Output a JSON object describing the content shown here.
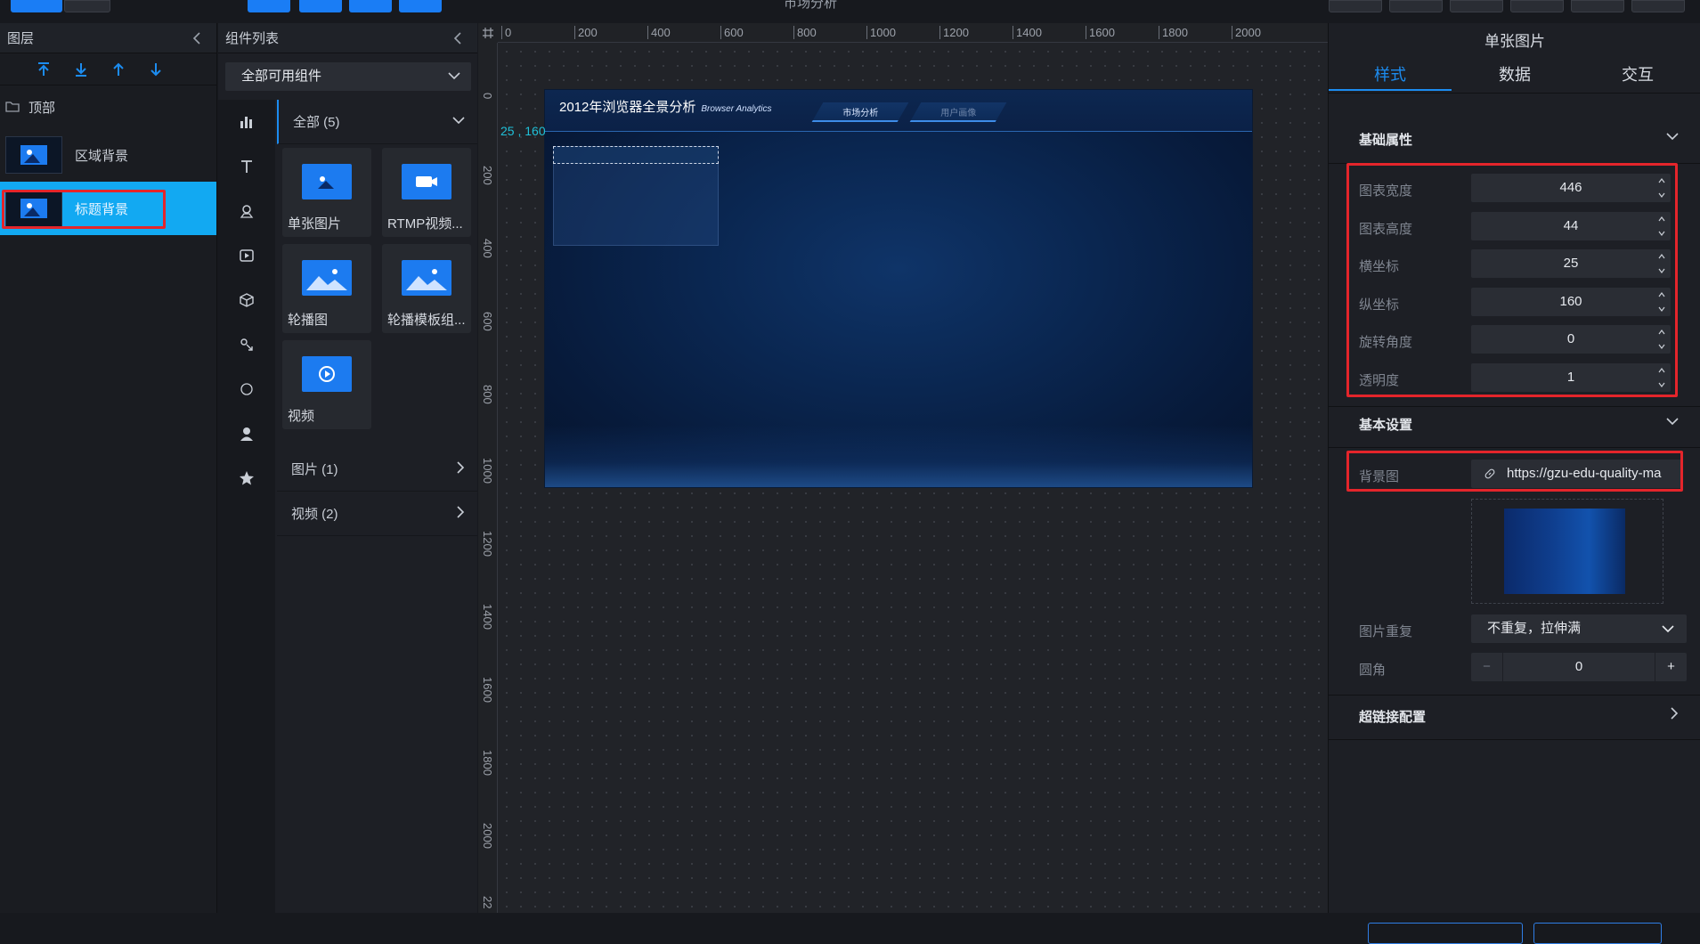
{
  "topbar": {
    "title": "市场分析"
  },
  "layers": {
    "title": "图层",
    "group": "顶部",
    "items": [
      {
        "label": "区域背景"
      },
      {
        "label": "标题背景"
      }
    ]
  },
  "components": {
    "title": "组件列表",
    "filter": "全部可用组件",
    "groups": [
      {
        "label": "全部 (5)"
      },
      {
        "label": "图片 (1)"
      },
      {
        "label": "视频 (2)"
      }
    ],
    "tiles": [
      {
        "label": "单张图片"
      },
      {
        "label": "RTMP视频..."
      },
      {
        "label": "轮播图"
      },
      {
        "label": "轮播模板组..."
      },
      {
        "label": "视频"
      }
    ]
  },
  "canvas": {
    "ruler_top": [
      "0",
      "200",
      "400",
      "600",
      "800",
      "1000",
      "1200",
      "1400",
      "1600",
      "1800",
      "2000"
    ],
    "ruler_left": [
      "0",
      "200",
      "400",
      "600",
      "800",
      "1000",
      "1200",
      "1400",
      "1600",
      "1800",
      "2000",
      "22"
    ],
    "coord": "25 , 160",
    "screen_title": "2012年浏览器全景分析",
    "screen_subtitle": "Browser Analytics",
    "tab1": "市场分析",
    "tab2": "用户画像"
  },
  "props": {
    "title": "单张图片",
    "tabs": [
      "样式",
      "数据",
      "交互"
    ],
    "section_basic": "基础属性",
    "fields": [
      {
        "label": "图表宽度",
        "value": "446"
      },
      {
        "label": "图表高度",
        "value": "44"
      },
      {
        "label": "横坐标",
        "value": "25"
      },
      {
        "label": "纵坐标",
        "value": "160"
      },
      {
        "label": "旋转角度",
        "value": "0"
      },
      {
        "label": "透明度",
        "value": "1"
      }
    ],
    "section_settings": "基本设置",
    "bg_label": "背景图",
    "bg_value": "https://gzu-edu-quality-ma",
    "repeat_label": "图片重复",
    "repeat_value": "不重复，拉伸满",
    "radius_label": "圆角",
    "radius_value": "0",
    "section_link": "超链接配置"
  },
  "colors": {
    "accent": "#1c8cf0",
    "highlight": "#1da7f5",
    "annotation": "#e4252b"
  }
}
